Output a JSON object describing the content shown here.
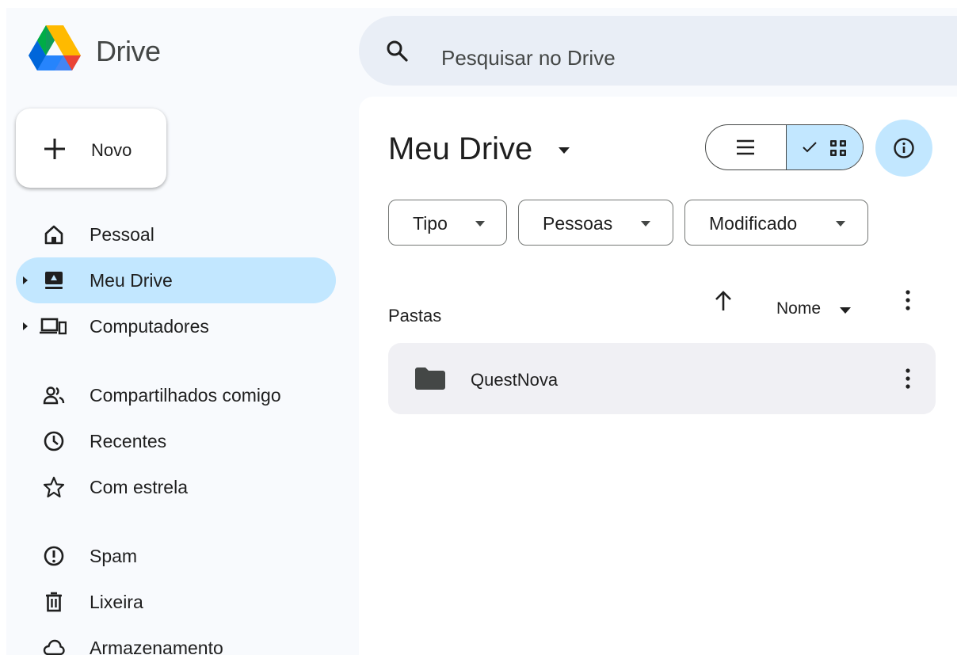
{
  "app": {
    "name": "Drive"
  },
  "search": {
    "placeholder": "Pesquisar no Drive"
  },
  "new_button": {
    "label": "Novo"
  },
  "sidebar": {
    "items": [
      {
        "label": "Pessoal",
        "icon": "home-icon",
        "active": false
      },
      {
        "label": "Meu Drive",
        "icon": "my-drive-icon",
        "active": true
      },
      {
        "label": "Computadores",
        "icon": "computers-icon",
        "active": false
      },
      {
        "label": "Compartilhados comigo",
        "icon": "shared-icon",
        "active": false
      },
      {
        "label": "Recentes",
        "icon": "clock-icon",
        "active": false
      },
      {
        "label": "Com estrela",
        "icon": "star-icon",
        "active": false
      },
      {
        "label": "Spam",
        "icon": "spam-icon",
        "active": false
      },
      {
        "label": "Lixeira",
        "icon": "trash-icon",
        "active": false
      },
      {
        "label": "Armazenamento",
        "icon": "cloud-icon",
        "active": false
      }
    ]
  },
  "main": {
    "title": "Meu Drive",
    "view": "grid",
    "filters": [
      {
        "label": "Tipo"
      },
      {
        "label": "Pessoas"
      },
      {
        "label": "Modificado"
      }
    ],
    "section_title": "Pastas",
    "sort": {
      "label": "Nome"
    },
    "folders": [
      {
        "name": "QuestNova"
      }
    ]
  },
  "colors": {
    "app_background": "#f8fafd",
    "search_background": "#e9eef6",
    "active_highlight": "#c2e7ff",
    "folder_card": "#f0f0f4",
    "icon_gray": "#444746",
    "text": "#1f1f1f"
  }
}
